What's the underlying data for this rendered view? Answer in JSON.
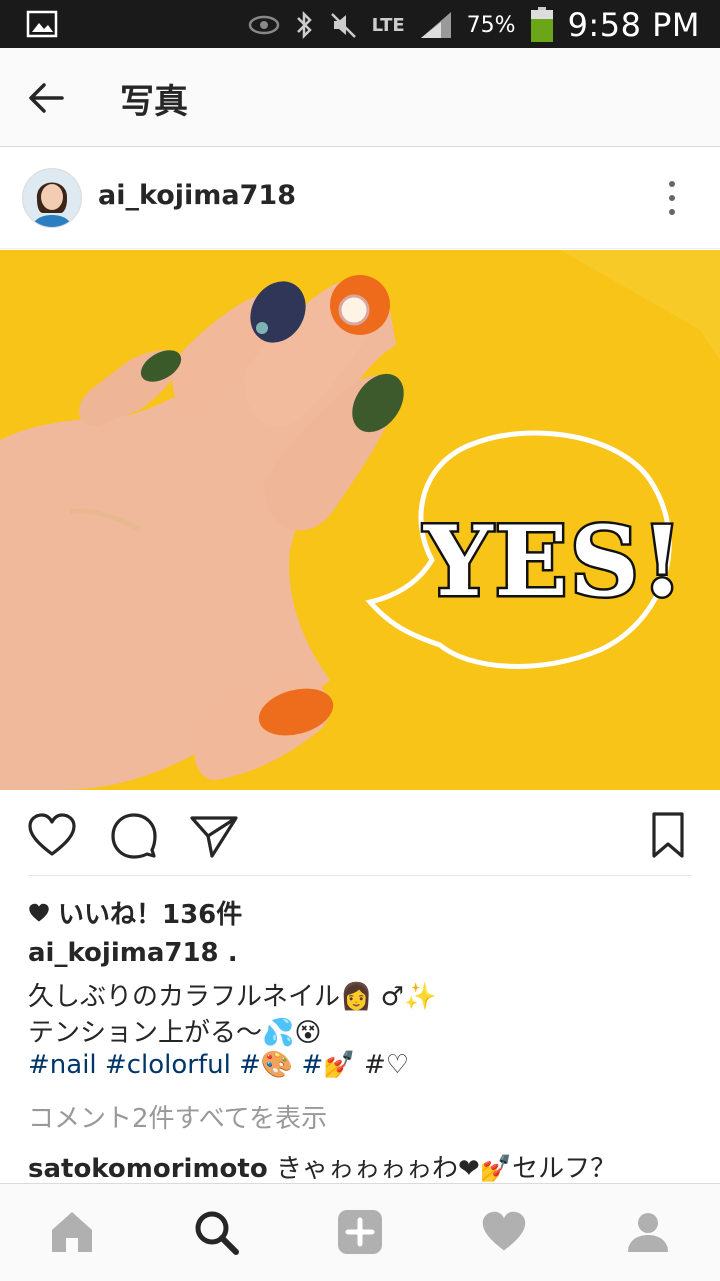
{
  "status_bar": {
    "battery": "75%",
    "network": "LTE",
    "time": "9:58 PM"
  },
  "app_bar": {
    "title": "写真"
  },
  "post": {
    "username": "ai_kojima718",
    "photo_text": "YES!",
    "likes": "いいね！136件",
    "caption_user": "ai_kojima718 .",
    "caption_line1": "久しぶりのカラフルネイル👩 ♂✨",
    "caption_line2": "テンション上がる〜💦😵",
    "hashtag1": "#nail",
    "hashtag2": "#clolorful",
    "hashtag3": "#🎨",
    "hashtag4": "#💅",
    "hashtag5": "#♡",
    "view_comments": "コメント2件すべてを表示",
    "comment_user": "satokomorimoto",
    "comment_text": "きゃゎゎゎゎわ❤💅セルフ？"
  },
  "colors": {
    "accent": "#003569",
    "photo_bg": "#f7c417",
    "muted": "#999999"
  }
}
